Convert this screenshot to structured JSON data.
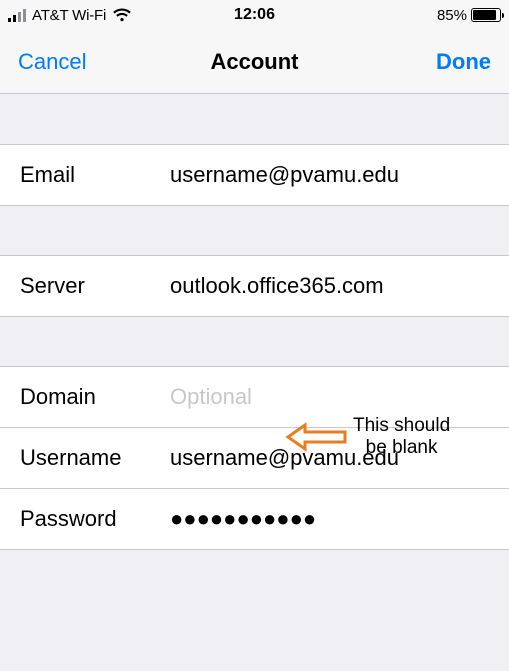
{
  "status": {
    "carrier": "AT&T Wi-Fi",
    "time": "12:06",
    "battery_pct": "85%",
    "battery_fill_pct": 85,
    "signal_active_bars": 2
  },
  "nav": {
    "cancel": "Cancel",
    "title": "Account",
    "done": "Done"
  },
  "rows": {
    "email_label": "Email",
    "email_value": "username@pvamu.edu",
    "server_label": "Server",
    "server_value": "outlook.office365.com",
    "domain_label": "Domain",
    "domain_value": "",
    "domain_placeholder": "Optional",
    "username_label": "Username",
    "username_value": "username@pvamu.edu",
    "password_label": "Password",
    "password_value": "●●●●●●●●●●●"
  },
  "annotation": {
    "text": "This should\nbe blank",
    "arrow_color": "#e67e22"
  }
}
